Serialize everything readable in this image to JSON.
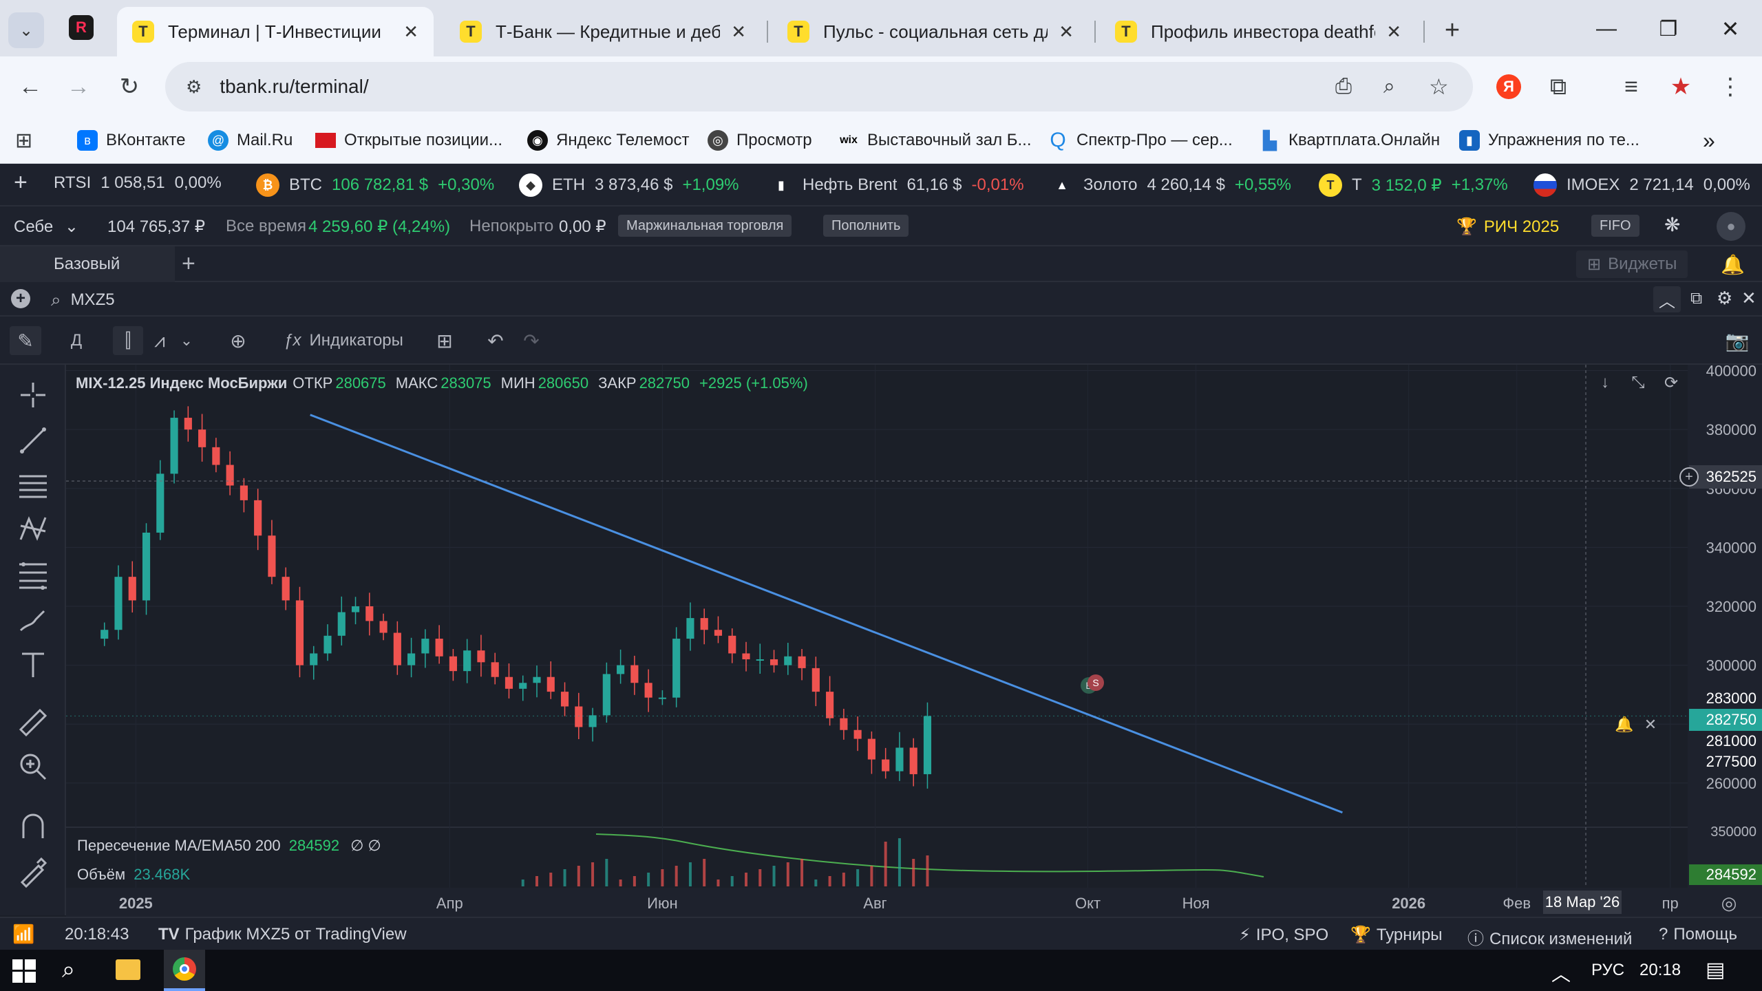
{
  "browser": {
    "tabs": [
      {
        "favicon": "T",
        "label": "Терминал | Т-Инвестиции",
        "active": true
      },
      {
        "favicon": "T",
        "label": "Т-Банк — Кредитные и дебетс",
        "active": false
      },
      {
        "favicon": "T",
        "label": "Пульс - социальная сеть для и",
        "active": false
      },
      {
        "favicon": "T",
        "label": "Профиль инвестора deathfeel",
        "active": false
      }
    ],
    "url": "tbank.ru/terminal/",
    "bookmarks": [
      {
        "label": "ВКонтакте",
        "icon": "vk-icon",
        "color": "#0077ff"
      },
      {
        "label": "Mail.Ru",
        "icon": "mailru-icon",
        "color": "#168de2"
      },
      {
        "label": "Открытые позиции...",
        "icon": "flag-icon",
        "color": "#d71920"
      },
      {
        "label": "Яндекс Телемост",
        "icon": "telemost-icon",
        "color": "#111111"
      },
      {
        "label": "Просмотр",
        "icon": "viewer-icon",
        "color": "#444444"
      },
      {
        "label": "Выставочный зал Б...",
        "icon": "wix-icon",
        "color": "#000000"
      },
      {
        "label": "Спектр-Про — сер...",
        "icon": "spektr-icon",
        "color": "#1e88e5"
      },
      {
        "label": "Квартплата.Онлайн",
        "icon": "kvartplata-icon",
        "color": "#2e7dd7"
      },
      {
        "label": "Упражнения по те...",
        "icon": "book-icon",
        "color": "#1565c0"
      }
    ]
  },
  "ticker": [
    {
      "name": "RTSI",
      "price": "1 058,51",
      "change": "0,00%",
      "dir": "flat",
      "icon": "rtsi-icon",
      "color": ""
    },
    {
      "name": "BTC",
      "price": "106 782,81 $",
      "change": "+0,30%",
      "dir": "up",
      "icon": "bitcoin-icon",
      "color": "#f7931a"
    },
    {
      "name": "ETH",
      "price": "3 873,46 $",
      "change": "+1,09%",
      "dir": "up",
      "icon": "ethereum-icon",
      "color": "#ffffff"
    },
    {
      "name": "Нефть Brent",
      "price": "61,16 $",
      "change": "-0,01%",
      "dir": "dn",
      "icon": "oil-icon",
      "color": ""
    },
    {
      "name": "Золото",
      "price": "4 260,14 $",
      "change": "+0,55%",
      "dir": "up",
      "icon": "gold-icon",
      "color": ""
    },
    {
      "name": "T",
      "price": "3 152,0 ₽",
      "change": "+1,37%",
      "dir": "up",
      "icon": "tbank-icon",
      "color": "#ffdd2d"
    },
    {
      "name": "IMOEX",
      "price": "2 721,14",
      "change": "0,00%",
      "dir": "flat",
      "icon": "russia-flag-icon",
      "color": ""
    }
  ],
  "account": {
    "selector": "Себе",
    "balance": "104 765,37 ₽",
    "alltime_label": "Все время",
    "alltime_value": "4 259,60 ₽ (4,24%)",
    "uncovered_label": "Непокрыто",
    "uncovered_value": "0,00 ₽",
    "margin_chip": "Маржинальная торговля",
    "deposit_chip": "Пополнить",
    "rich_label": "РИЧ 2025",
    "fifo_chip": "FIFO"
  },
  "workspace": {
    "active_tab": "Базовый",
    "widgets_label": "Виджеты"
  },
  "symbol": {
    "search_value": "MXZ5"
  },
  "chart_toolbar": {
    "interval": "Д",
    "indicators_label": "Индикаторы"
  },
  "legend": {
    "title": "MIX-12.25 Индекс МосБиржи",
    "open_label": "ОТКР",
    "open": "280675",
    "high_label": "МАКС",
    "high": "283075",
    "low_label": "МИН",
    "low": "280650",
    "close_label": "ЗАКР",
    "close": "282750",
    "change": "+2925 (+1.05%)"
  },
  "indicators": {
    "ma_label": "Пересечение MA/EMA50 200",
    "ma_value": "284592",
    "ma_extra": "∅  ∅",
    "vol_label": "Объём",
    "vol_value": "23.468K"
  },
  "price_badges": {
    "crosshair": "362525",
    "high": "283000",
    "last": "282750",
    "low1": "281000",
    "low2": "277500",
    "ma": "284592",
    "sub_top": "350000"
  },
  "time_badge": "18 Мар '26",
  "chart_data": {
    "type": "candlestick",
    "y_ticks": [
      260000,
      280000,
      300000,
      320000,
      340000,
      360000,
      380000,
      400000
    ],
    "y_range": [
      245000,
      402000
    ],
    "x_labels": [
      "2025",
      "Апр",
      "Июн",
      "Авг",
      "Окт",
      "Ноя",
      "2026",
      "Фев",
      "пр"
    ],
    "x_label_days": [
      0,
      90,
      151,
      212,
      273,
      304,
      365,
      396,
      440
    ],
    "x_range_days": [
      -20,
      445
    ],
    "candles_every_4_days": {
      "start_day": -9,
      "step_days": 4,
      "close": [
        312000,
        330000,
        322000,
        345000,
        365000,
        384000,
        380000,
        374000,
        368000,
        361000,
        356000,
        344000,
        330000,
        322000,
        300000,
        304000,
        310000,
        318000,
        320000,
        315000,
        311000,
        300000,
        304000,
        309000,
        303000,
        298000,
        305000,
        301000,
        296000,
        292000,
        294000,
        296000,
        291000,
        286000,
        279000,
        283000,
        297000,
        300000,
        294000,
        289000,
        289000,
        309000,
        316000,
        312000,
        310000,
        304000,
        302000,
        302000,
        300000,
        303000,
        299000,
        291000,
        282000,
        278000,
        275000,
        268000,
        264000,
        272000,
        263000,
        282750
      ]
    },
    "trendline": {
      "from": {
        "day": 50,
        "price": 385000
      },
      "to": {
        "day": 346,
        "price": 250000
      }
    },
    "ma_line": "green moving average in lower pane",
    "volume_bars": "small red/green volume bars near the end of series"
  },
  "status": {
    "time": "20:18:43",
    "tv_label": "График MXZ5 от TradingView",
    "ipo": "IPO, SPO",
    "tournaments": "Турниры",
    "changelog": "Список изменений",
    "help": "Помощь"
  },
  "taskbar": {
    "lang": "РУС",
    "time": "20:18"
  },
  "colors": {
    "up": "#26a69a",
    "down": "#ef5350",
    "trend": "#4a90e2",
    "ma": "#4caf50",
    "bg": "#1b1f28"
  }
}
